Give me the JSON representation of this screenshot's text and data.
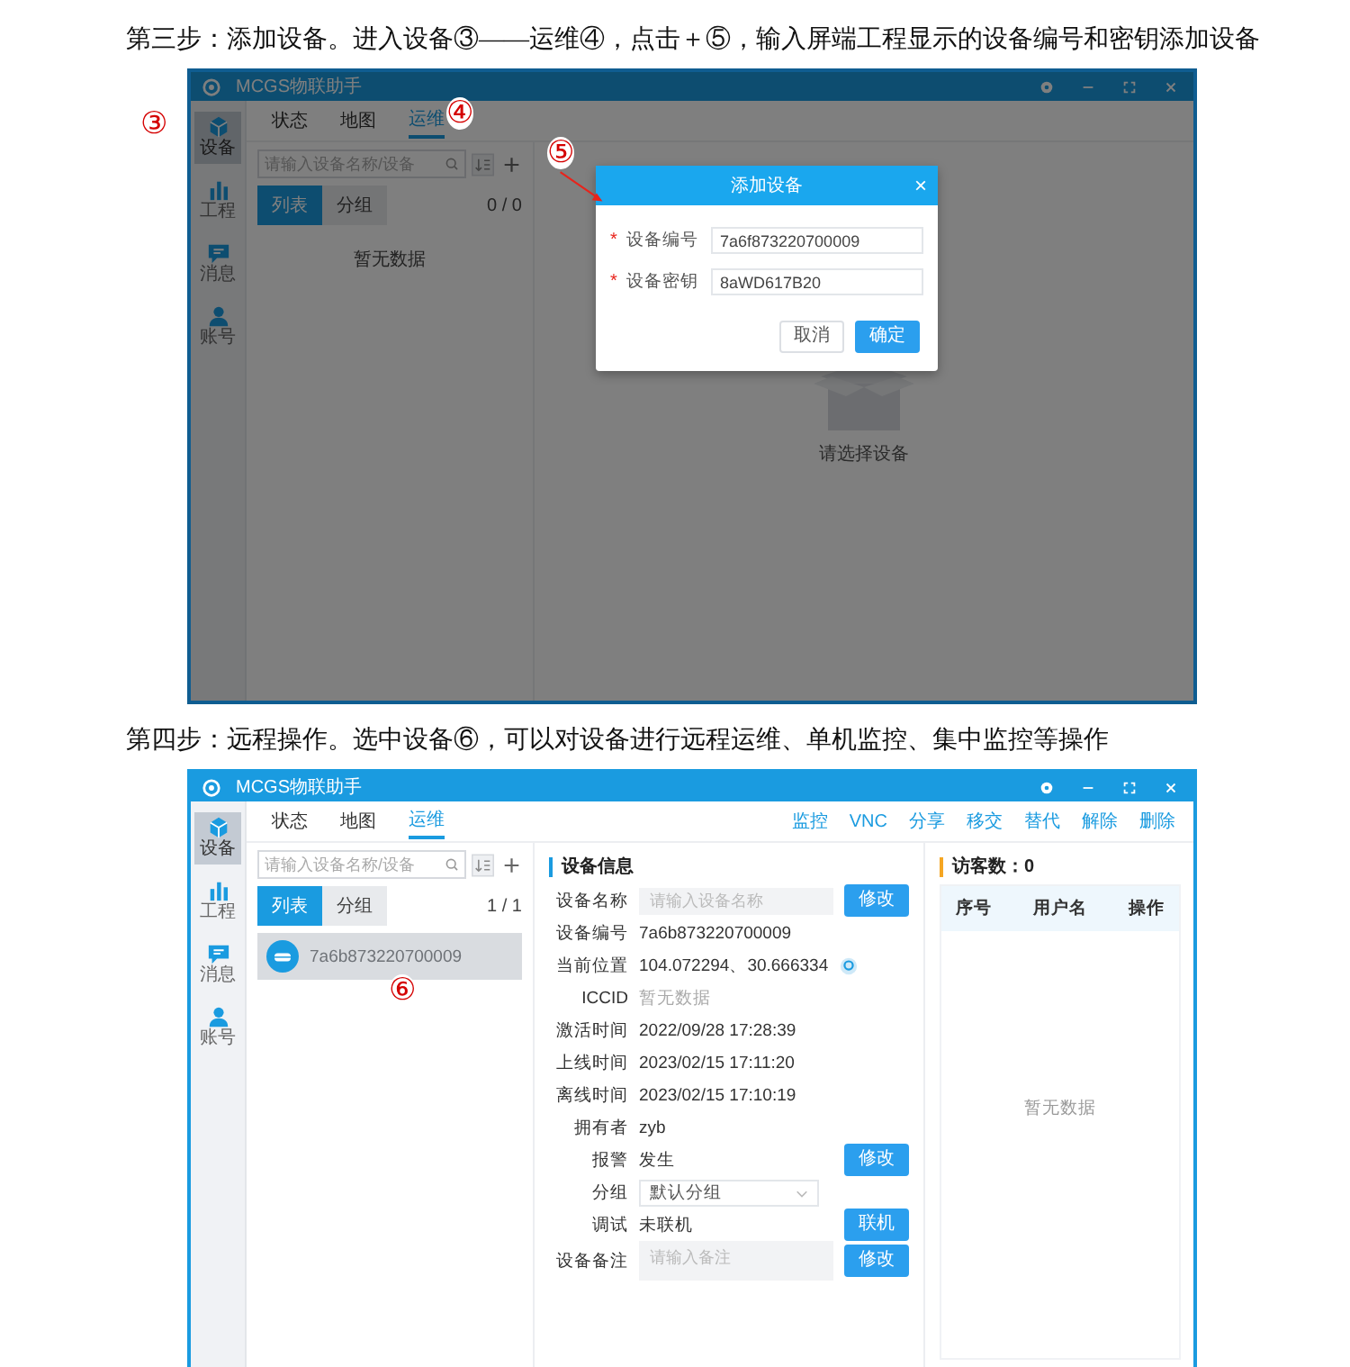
{
  "step3": {
    "caption": "第三步：添加设备。进入设备③——运维④，点击＋⑤，输入屏端工程显示的设备编号和密钥添加设备",
    "app": {
      "title": "MCGS物联助手",
      "dimmed": true,
      "nav": [
        {
          "label": "设备",
          "selected": true
        },
        {
          "label": "工程",
          "selected": false
        },
        {
          "label": "消息",
          "selected": false
        },
        {
          "label": "账号",
          "selected": false
        }
      ],
      "tabs": [
        {
          "label": "状态",
          "selected": false
        },
        {
          "label": "地图",
          "selected": false
        },
        {
          "label": "运维",
          "selected": true
        }
      ],
      "search": {
        "placeholder": "请输入设备名称/设备"
      },
      "view_toggle": [
        {
          "label": "列表",
          "selected": true
        },
        {
          "label": "分组",
          "selected": false
        }
      ],
      "count": "0 / 0",
      "empty_list": "暂无数据",
      "empty_detail": "请选择设备"
    },
    "dialog": {
      "title": "添加设备",
      "close": "×",
      "fields": [
        {
          "label": "设备编号",
          "value": "7a6f873220700009",
          "required_mark": "*"
        },
        {
          "label": "设备密钥",
          "value": "8aWD617B20",
          "required_mark": "*"
        }
      ],
      "buttons": [
        {
          "label": "取消",
          "kind": "secondary"
        },
        {
          "label": "确定",
          "kind": "primary"
        }
      ]
    },
    "markers": [
      {
        "label": "③"
      },
      {
        "label": "④"
      },
      {
        "label": "⑤"
      }
    ],
    "pointer_arrow": true
  },
  "step4": {
    "caption": "第四步：远程操作。选中设备⑥，可以对设备进行远程运维、单机监控、集中监控等操作",
    "app": {
      "title": "MCGS物联助手",
      "dimmed": false,
      "nav": [
        {
          "label": "设备",
          "selected": true
        },
        {
          "label": "工程",
          "selected": false
        },
        {
          "label": "消息",
          "selected": false
        },
        {
          "label": "账号",
          "selected": false
        }
      ],
      "tabs": [
        {
          "label": "状态",
          "selected": false
        },
        {
          "label": "地图",
          "selected": false
        },
        {
          "label": "运维",
          "selected": true
        }
      ],
      "actions": [
        "监控",
        "VNC",
        "分享",
        "移交",
        "替代",
        "解除",
        "删除"
      ],
      "search": {
        "placeholder": "请输入设备名称/设备"
      },
      "view_toggle": [
        {
          "label": "列表",
          "selected": true
        },
        {
          "label": "分组",
          "selected": false
        }
      ],
      "count": "1 / 1",
      "devices": [
        {
          "name": "7a6b873220700009",
          "selected": true
        }
      ]
    },
    "detail": {
      "title": "设备信息",
      "rows": [
        {
          "kind": "input",
          "label": "设备名称",
          "placeholder": "请输入设备名称",
          "button": "修改"
        },
        {
          "kind": "text",
          "label": "设备编号",
          "value": "7a6b873220700009"
        },
        {
          "kind": "location",
          "label": "当前位置",
          "value": "104.072294、30.666334"
        },
        {
          "kind": "empty",
          "label": "ICCID",
          "value": "暂无数据"
        },
        {
          "kind": "text",
          "label": "激活时间",
          "value": "2022/09/28 17:28:39"
        },
        {
          "kind": "text",
          "label": "上线时间",
          "value": "2023/02/15 17:11:20"
        },
        {
          "kind": "text",
          "label": "离线时间",
          "value": "2023/02/15 17:10:19"
        },
        {
          "kind": "text",
          "label": "拥有者",
          "value": "zyb"
        },
        {
          "kind": "text_button",
          "label": "报警",
          "value": "发生",
          "button": "修改"
        },
        {
          "kind": "select",
          "label": "分组",
          "value": "默认分组"
        },
        {
          "kind": "text_button",
          "label": "调试",
          "value": "未联机",
          "button": "联机"
        },
        {
          "kind": "textarea",
          "label": "设备备注",
          "placeholder": "请输入备注",
          "button": "修改"
        }
      ]
    },
    "visitors": {
      "title": "访客数：0",
      "columns": [
        "序号",
        "用户名",
        "操作"
      ],
      "empty": "暂无数据"
    },
    "markers": [
      {
        "label": "⑥"
      }
    ]
  }
}
